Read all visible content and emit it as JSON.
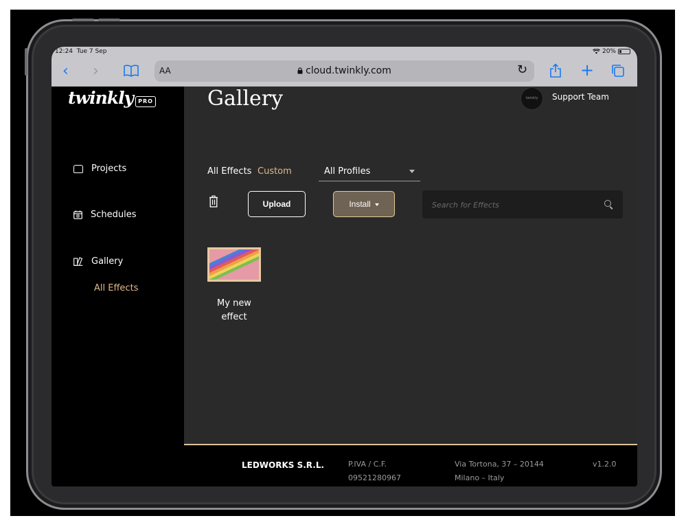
{
  "status": {
    "time": "12:24",
    "date": "Tue 7 Sep",
    "battery": "20%"
  },
  "browser": {
    "text_size_label": "AA",
    "url": "cloud.twinkly.com",
    "icons": [
      "back-icon",
      "forward-icon",
      "bookmarks-icon",
      "lock-icon",
      "reload-icon",
      "share-icon",
      "new-tab-icon",
      "tabs-icon"
    ],
    "accent_color": "#1a78f2"
  },
  "brand": {
    "logo": "twinkly",
    "badge": "PRO"
  },
  "sidebar": {
    "items": [
      {
        "label": "Projects",
        "icon": "projects-icon"
      },
      {
        "label": "Schedules",
        "icon": "calendar-icon"
      },
      {
        "label": "Gallery",
        "icon": "gallery-icon"
      }
    ],
    "sub_item": "All Effects"
  },
  "header": {
    "title": "Gallery",
    "user": "Support Team"
  },
  "filters": {
    "all": "All Effects",
    "custom": "Custom",
    "profile_selected": "All Profiles"
  },
  "toolbar": {
    "upload_label": "Upload",
    "install_label": "Install",
    "search_placeholder": "Search for Effects"
  },
  "effects": [
    {
      "name_line1": "My new",
      "name_line2": "effect"
    }
  ],
  "footer": {
    "company": "LEDWORKS S.R.L.",
    "vat_label": "P.IVA / C.F.",
    "vat_number": "09521280967",
    "address_line1": "Via Tortona, 37 – 20144",
    "address_line2": "Milano – Italy",
    "version": "v1.2.0"
  },
  "colors": {
    "accent_gold": "#e0b98a",
    "install_bg": "#6f6353",
    "main_bg": "#2a2a2a"
  }
}
